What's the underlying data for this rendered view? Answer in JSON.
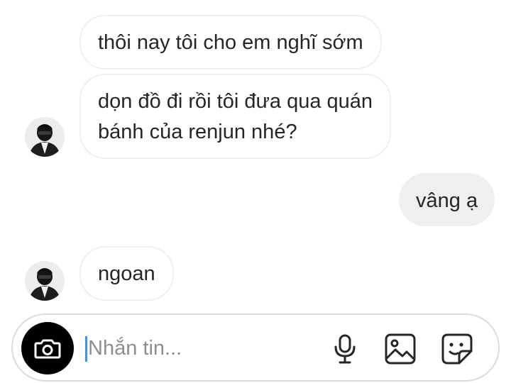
{
  "conversation": {
    "messages": [
      {
        "direction": "incoming",
        "lines": [
          "thôi nay tôi cho em nghĩ sớm"
        ]
      },
      {
        "direction": "incoming",
        "lines": [
          "dọn đồ đi rồi tôi đưa qua quán",
          "bánh của renjun nhé?"
        ]
      },
      {
        "direction": "outgoing",
        "lines": [
          "vâng ạ"
        ]
      },
      {
        "direction": "incoming",
        "lines": [
          "ngoan"
        ]
      }
    ]
  },
  "composer": {
    "placeholder": "Nhắn tin...",
    "value": "",
    "icons": [
      "camera-icon",
      "microphone-icon",
      "image-icon",
      "sticker-icon"
    ]
  },
  "colors": {
    "incoming_border": "#efefef",
    "outgoing_bubble": "#efefef",
    "camera_button": "#000000",
    "caret": "#3897f0",
    "text": "#262626",
    "placeholder": "#8e8e8e"
  }
}
